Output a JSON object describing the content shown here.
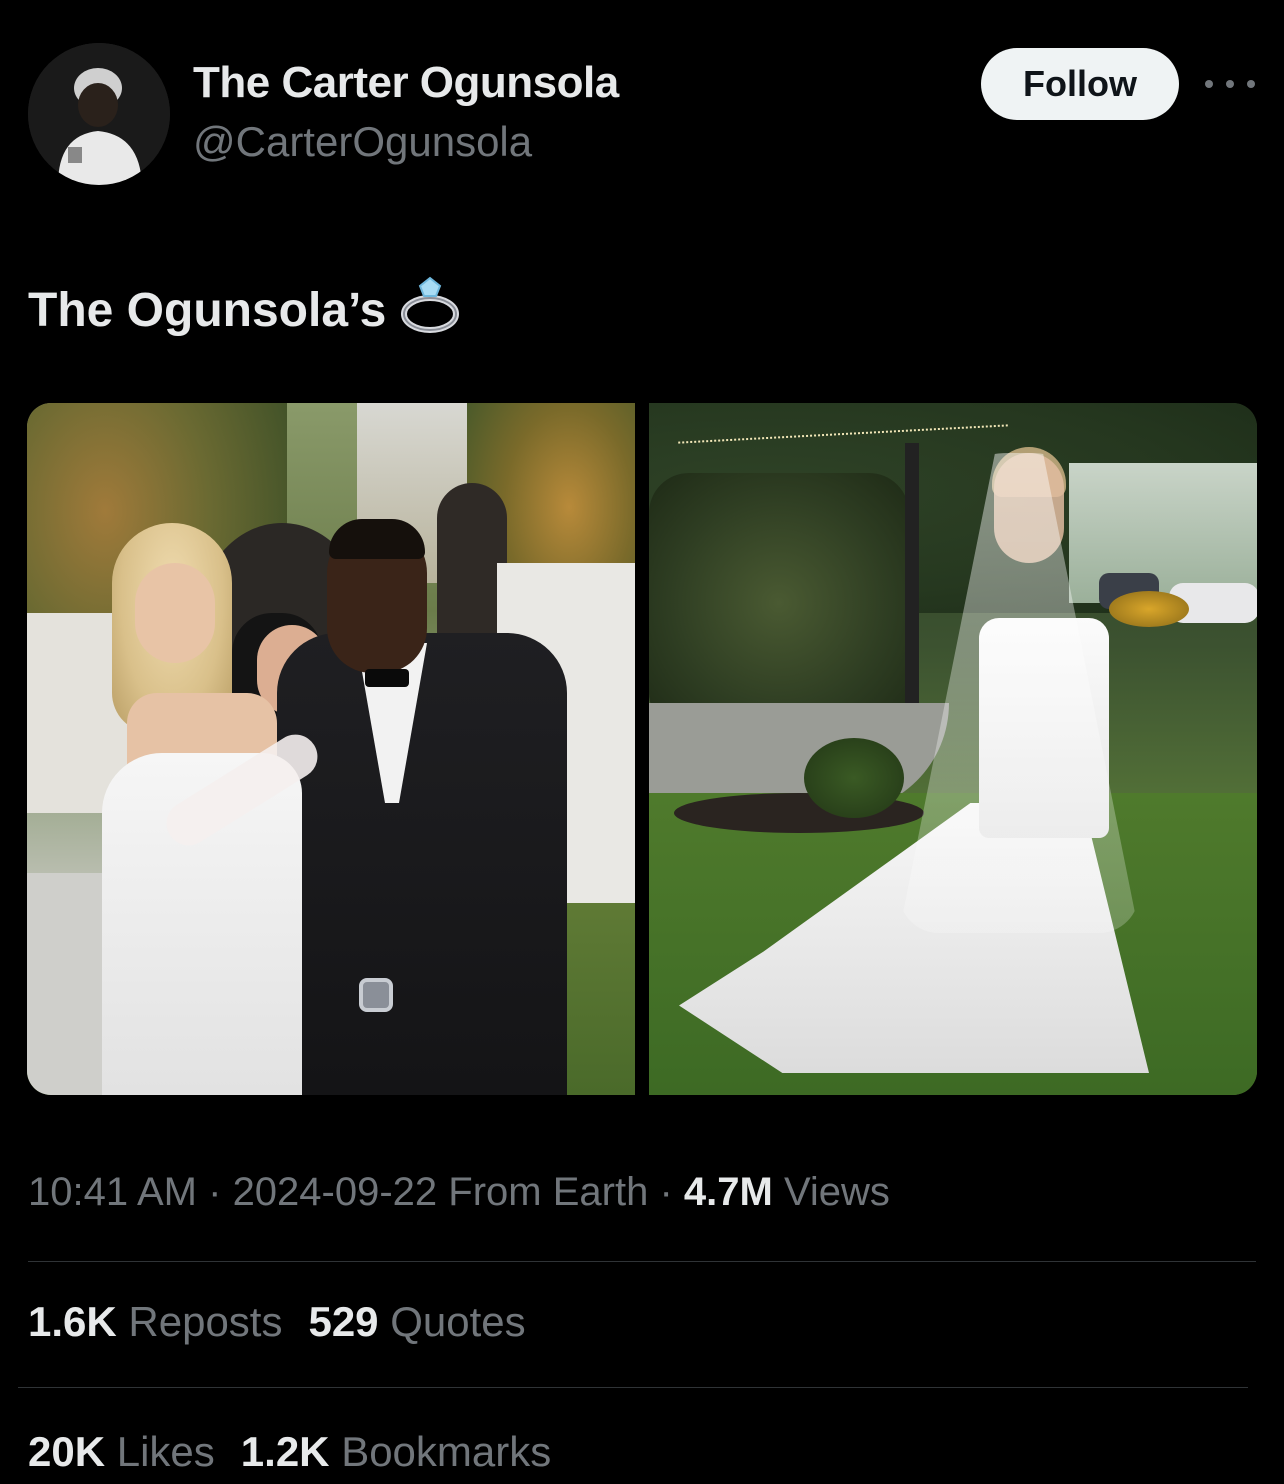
{
  "author": {
    "name": "The Carter Ogunsola",
    "handle": "@CarterOgunsola",
    "follow_label": "Follow"
  },
  "post": {
    "text": "The Ogunsola’s",
    "emoji": "💍"
  },
  "media": {
    "count": 2
  },
  "meta": {
    "time": "10:41 AM",
    "separator1": " · ",
    "date": "2024-09-22",
    "source": "From Earth",
    "separator2": " · ",
    "views_count": "4.7M",
    "views_label": "Views"
  },
  "stats": {
    "reposts_count": "1.6K",
    "reposts_label": "Reposts",
    "quotes_count": "529",
    "quotes_label": "Quotes",
    "likes_count": "20K",
    "likes_label": "Likes",
    "bookmarks_count": "1.2K",
    "bookmarks_label": "Bookmarks"
  },
  "colors": {
    "background": "#000000",
    "primary_text": "#e7e9ea",
    "secondary_text": "#71767b",
    "follow_button_bg": "#eff3f4",
    "divider": "#2f3336"
  },
  "icons": {
    "more": "more-horizontal-icon",
    "ring": "ring-emoji-icon"
  }
}
